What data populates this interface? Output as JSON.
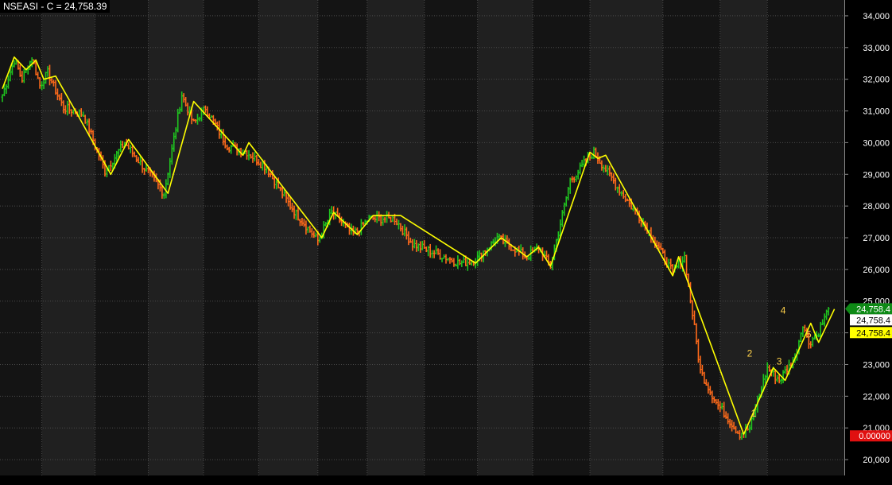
{
  "chart_data": {
    "type": "bar",
    "subtype": "ohlc",
    "title": "NSEASI - C = 24,758.39",
    "ylim": [
      19500,
      34500
    ],
    "yticks": [
      20000,
      21000,
      22000,
      23000,
      24000,
      25000,
      26000,
      27000,
      28000,
      29000,
      30000,
      31000,
      32000,
      33000,
      34000
    ],
    "ytick_labels": [
      "20,000",
      "21,000",
      "22,000",
      "23,000",
      "24,000",
      "25,000",
      "26,000",
      "27,000",
      "28,000",
      "29,000",
      "30,000",
      "31,000",
      "32,000",
      "33,000",
      "34,000"
    ],
    "grid": true,
    "colors": {
      "background": "#1c1c1c",
      "band_dark": "#141414",
      "band_light": "#202020",
      "grid": "#4a4a4a",
      "up_bar": "#1fc41f",
      "down_bar": "#ff6a1a",
      "zigzag": "#ffff00",
      "wave_label": "#ffd24a",
      "axis_text": "#ffffff"
    },
    "price_series": [
      {
        "x": 0,
        "y": 31500
      },
      {
        "x": 6,
        "y": 32600
      },
      {
        "x": 10,
        "y": 32000
      },
      {
        "x": 15,
        "y": 32700
      },
      {
        "x": 19,
        "y": 31800
      },
      {
        "x": 23,
        "y": 32200
      },
      {
        "x": 31,
        "y": 31100
      },
      {
        "x": 41,
        "y": 30900
      },
      {
        "x": 52,
        "y": 29100
      },
      {
        "x": 62,
        "y": 30000
      },
      {
        "x": 72,
        "y": 29200
      },
      {
        "x": 82,
        "y": 28400
      },
      {
        "x": 91,
        "y": 31500
      },
      {
        "x": 97,
        "y": 30600
      },
      {
        "x": 103,
        "y": 31100
      },
      {
        "x": 114,
        "y": 29900
      },
      {
        "x": 124,
        "y": 29700
      },
      {
        "x": 134,
        "y": 29200
      },
      {
        "x": 146,
        "y": 28000
      },
      {
        "x": 160,
        "y": 26900
      },
      {
        "x": 167,
        "y": 27800
      },
      {
        "x": 178,
        "y": 27100
      },
      {
        "x": 186,
        "y": 27600
      },
      {
        "x": 199,
        "y": 27600
      },
      {
        "x": 208,
        "y": 26800
      },
      {
        "x": 220,
        "y": 26500
      },
      {
        "x": 232,
        "y": 26200
      },
      {
        "x": 240,
        "y": 26300
      },
      {
        "x": 251,
        "y": 27000
      },
      {
        "x": 266,
        "y": 26400
      },
      {
        "x": 272,
        "y": 26700
      },
      {
        "x": 278,
        "y": 26100
      },
      {
        "x": 288,
        "y": 28800
      },
      {
        "x": 300,
        "y": 29700
      },
      {
        "x": 312,
        "y": 28600
      },
      {
        "x": 327,
        "y": 27300
      },
      {
        "x": 340,
        "y": 25900
      },
      {
        "x": 346,
        "y": 26400
      },
      {
        "x": 354,
        "y": 22800
      },
      {
        "x": 362,
        "y": 21800
      },
      {
        "x": 374,
        "y": 20800
      },
      {
        "x": 379,
        "y": 21000
      },
      {
        "x": 388,
        "y": 22900
      },
      {
        "x": 394,
        "y": 22500
      },
      {
        "x": 402,
        "y": 23200
      },
      {
        "x": 406,
        "y": 24300
      },
      {
        "x": 409,
        "y": 23700
      },
      {
        "x": 413,
        "y": 23900
      },
      {
        "x": 419,
        "y": 24758.4
      }
    ],
    "zigzag": [
      {
        "x": 0,
        "y": 31700
      },
      {
        "x": 6,
        "y": 32700
      },
      {
        "x": 12,
        "y": 32300
      },
      {
        "x": 17,
        "y": 32600
      },
      {
        "x": 21,
        "y": 32000
      },
      {
        "x": 27,
        "y": 32100
      },
      {
        "x": 38,
        "y": 30900
      },
      {
        "x": 55,
        "y": 29000
      },
      {
        "x": 64,
        "y": 30100
      },
      {
        "x": 84,
        "y": 28400
      },
      {
        "x": 97,
        "y": 31300
      },
      {
        "x": 122,
        "y": 29600
      },
      {
        "x": 125,
        "y": 30000
      },
      {
        "x": 162,
        "y": 27000
      },
      {
        "x": 168,
        "y": 27800
      },
      {
        "x": 180,
        "y": 27100
      },
      {
        "x": 188,
        "y": 27700
      },
      {
        "x": 202,
        "y": 27700
      },
      {
        "x": 240,
        "y": 26200
      },
      {
        "x": 253,
        "y": 27000
      },
      {
        "x": 266,
        "y": 26400
      },
      {
        "x": 272,
        "y": 26700
      },
      {
        "x": 278,
        "y": 26100
      },
      {
        "x": 298,
        "y": 29700
      },
      {
        "x": 302,
        "y": 29500
      },
      {
        "x": 306,
        "y": 29600
      },
      {
        "x": 340,
        "y": 25800
      },
      {
        "x": 343,
        "y": 26400
      },
      {
        "x": 376,
        "y": 20800
      },
      {
        "x": 391,
        "y": 22900
      },
      {
        "x": 397,
        "y": 22500
      },
      {
        "x": 410,
        "y": 24300
      },
      {
        "x": 414,
        "y": 23700
      },
      {
        "x": 422,
        "y": 24750
      }
    ],
    "x_separators": [
      20,
      47,
      74,
      102,
      130,
      160,
      185,
      214,
      241,
      269,
      298,
      335,
      364,
      388
    ],
    "wave_labels": [
      {
        "label": "1",
        "x": 381,
        "y": 21350
      },
      {
        "label": "2",
        "x": 379,
        "y": 23250
      },
      {
        "label": "3",
        "x": 394,
        "y": 23000
      },
      {
        "label": "4",
        "x": 396,
        "y": 24600
      },
      {
        "label": "5",
        "x": 409,
        "y": 23850
      }
    ],
    "markers": [
      {
        "name": "close-marker",
        "label": "24,758.4",
        "value": 24758.4,
        "bg": "#0e8a16",
        "fg": "#ffffff",
        "arrow": true
      },
      {
        "name": "price-marker",
        "label": "24,758.4",
        "value": 24408.4,
        "bg": "#ffffff",
        "fg": "#000000",
        "arrow": false
      },
      {
        "name": "zigzag-marker",
        "label": "24,758.4",
        "value": 24008.4,
        "bg": "#ffff00",
        "fg": "#000000",
        "arrow": false
      },
      {
        "name": "indicator-marker",
        "label": "0.00000",
        "value": 20748.4,
        "bg": "#e01010",
        "fg": "#ffffff",
        "arrow": false
      }
    ]
  }
}
